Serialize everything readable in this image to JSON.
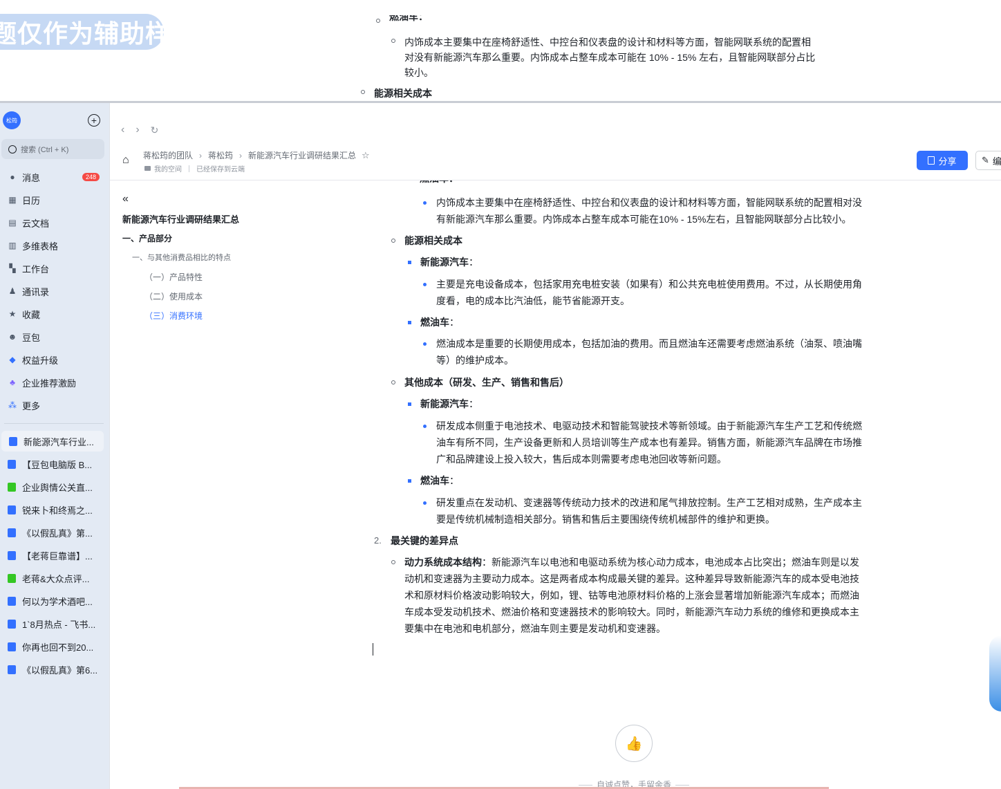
{
  "watermark": "题仅作为辅助样例",
  "top_doc": {
    "heading": "燃油车：",
    "para_line1": "内饰成本主要集中在座椅舒适性、中控台和仪表盘的设计和材料等方面，智能网联系统的配置相",
    "para_line2": "对没有新能源汽车那么重要。内饰成本占整车成本可能在 10% - 15% 左右，且智能网联部分占比",
    "para_line3": "较小。",
    "bullet": "能源相关成本"
  },
  "sidebar": {
    "logo": "松筠",
    "search_placeholder": "搜索 (Ctrl + K)",
    "nav": [
      {
        "label": "消息",
        "icon": "chat-icon",
        "badge": "248"
      },
      {
        "label": "日历",
        "icon": "calendar-icon"
      },
      {
        "label": "云文档",
        "icon": "cloud-doc-icon"
      },
      {
        "label": "多维表格",
        "icon": "table-icon"
      },
      {
        "label": "工作台",
        "icon": "grid-icon"
      },
      {
        "label": "通讯录",
        "icon": "contacts-icon"
      },
      {
        "label": "收藏",
        "icon": "star-icon"
      },
      {
        "label": "豆包",
        "icon": "doubao-icon"
      },
      {
        "label": "权益升级",
        "icon": "diamond-icon"
      },
      {
        "label": "企业推荐激励",
        "icon": "users-icon"
      },
      {
        "label": "更多",
        "icon": "more-icon"
      }
    ],
    "docs": [
      {
        "label": "新能源汽车行业...",
        "color": "#3370ff"
      },
      {
        "label": "【豆包电脑版 B...",
        "color": "#3370ff"
      },
      {
        "label": "企业舆情公关直...",
        "color": "#34c724"
      },
      {
        "label": "锐来卜和终焉之...",
        "color": "#3370ff"
      },
      {
        "label": "《以假乱真》第...",
        "color": "#3370ff"
      },
      {
        "label": "【老蒋巨靠谱】...",
        "color": "#3370ff"
      },
      {
        "label": "老蒋&大众点评...",
        "color": "#34c724"
      },
      {
        "label": "何以为学术酒吧...",
        "color": "#3370ff"
      },
      {
        "label": "1`8月热点 - 飞书...",
        "color": "#3370ff"
      },
      {
        "label": "你再也回不到20...",
        "color": "#3370ff"
      },
      {
        "label": "《以假乱真》第6...",
        "color": "#3370ff"
      }
    ]
  },
  "header": {
    "crumbs": [
      "蒋松筠的团队",
      "蒋松筠",
      "新能源汽车行业调研结果汇总"
    ],
    "space": "我的空间",
    "saved": "已经保存到云端",
    "share": "分享",
    "edit": "编"
  },
  "outline": {
    "title": "新能源汽车行业调研结果汇总",
    "items": [
      {
        "label": "一、产品部分",
        "level": 1
      },
      {
        "label": "一、与其他消费品相比的特点",
        "level": 2
      },
      {
        "label": "（一）产品特性",
        "level": 3
      },
      {
        "label": "（二）使用成本",
        "level": 3
      },
      {
        "label": "（三）消费环境",
        "level": 3
      }
    ]
  },
  "content": {
    "cut_heading": "燃油车：",
    "interior_line1": "内饰成本主要集中在座椅舒适性、中控台和仪表盘的设计和材料等方面，智能网联系统的配置相对没",
    "interior_line2": "有新能源汽车那么重要。内饰成本占整车成本可能在10% - 15%左右，且智能网联部分占比较小。",
    "energy_title": "能源相关成本",
    "nev_label": "新能源汽车",
    "fuel_label": "燃油车",
    "colon": "：",
    "energy_nev_line1": "主要是充电设备成本，包括家用充电桩安装（如果有）和公共充电桩使用费用。不过，从长期使用角",
    "energy_nev_line2": "度看，电的成本比汽油低，能节省能源开支。",
    "energy_fuel_line1": "燃油成本是重要的长期使用成本，包括加油的费用。而且燃油车还需要考虑燃油系统（油泵、喷油嘴",
    "energy_fuel_line2": "等）的维护成本。",
    "other_title": "其他成本（研发、生产、销售和售后）",
    "other_nev_line1": "研发成本侧重于电池技术、电驱动技术和智能驾驶技术等新领域。由于新能源汽车生产工艺和传统燃",
    "other_nev_line2": "油车有所不同，生产设备更新和人员培训等生产成本也有差异。销售方面，新能源汽车品牌在市场推",
    "other_nev_line3": "广和品牌建设上投入较大，售后成本则需要考虑电池回收等新问题。",
    "other_fuel_line1": "研发重点在发动机、变速器等传统动力技术的改进和尾气排放控制。生产工艺相对成熟，生产成本主",
    "other_fuel_line2": "要是传统机械制造相关部分。销售和售后主要围绕传统机械部件的维护和更换。",
    "num2": "2.",
    "key_diff": "最关键的差异点",
    "power_label": "动力系统成本结构",
    "power_line1": "：新能源汽车以电池和电驱动系统为核心动力成本，电池成本占比突出；燃油车则是以发",
    "power_line2": "动机和变速器为主要动力成本。这是两者成本构成最关键的差异。这种差异导致新能源汽车的成本受电池技",
    "power_line3": "术和原材料价格波动影响较大，例如，锂、钴等电池原材料价格的上涨会显著增加新能源汽车成本；而燃油",
    "power_line4": "车成本受发动机技术、燃油价格和变速器技术的影响较大。同时，新能源汽车动力系统的维修和更换成本主",
    "power_line5": "要集中在电池和电机部分，燃油车则主要是发动机和变速器。"
  },
  "footer": {
    "like_caption": "自诚点赞，手留余香"
  }
}
